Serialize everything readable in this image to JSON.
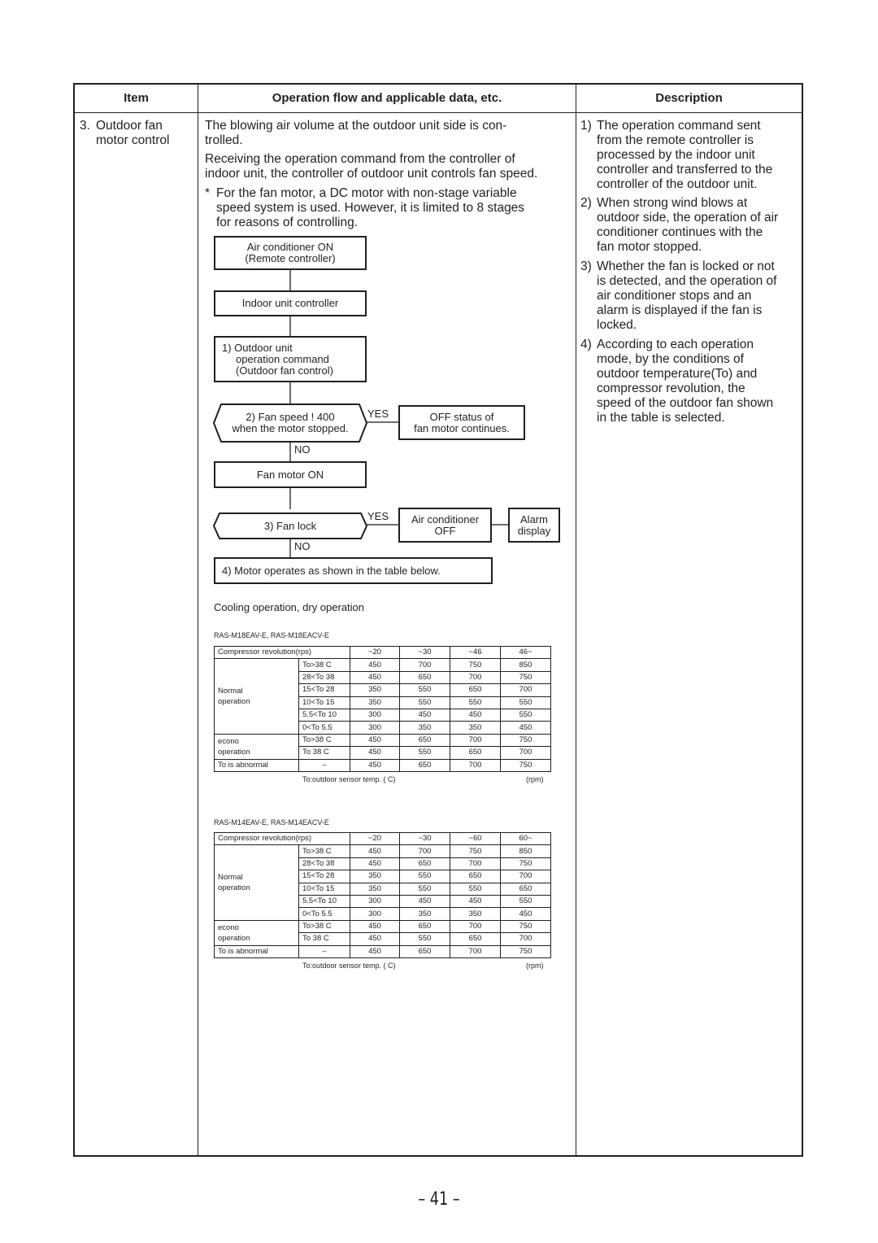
{
  "headers": {
    "item": "Item",
    "operation": "Operation flow and applicable data, etc.",
    "description": "Description"
  },
  "item": {
    "number": "3.",
    "line1": "Outdoor fan",
    "line2": "motor control"
  },
  "operation": {
    "para1_line1": "The blowing air volume at the outdoor unit side is con-",
    "para1_line2": "trolled.",
    "para2_line1": "Receiving the operation command from the controller of",
    "para2_line2": "indoor unit, the controller of outdoor unit controls fan speed.",
    "note_mark": "*",
    "note_line1": "For the fan motor, a DC motor with non-stage variable",
    "note_line2": "speed system is used. However, it is limited to 8 stages",
    "note_line3": "for reasons of controlling."
  },
  "flowchart": {
    "box_ac_on": [
      "Air conditioner ON",
      "(Remote controller)"
    ],
    "box_indoor": "Indoor unit controller",
    "box_outdoor_cmd": [
      "1)  Outdoor unit",
      "operation command",
      "(Outdoor fan control)"
    ],
    "decision_fan_speed": [
      "2) Fan speed !  400",
      "when the motor stopped."
    ],
    "box_off_status": [
      "OFF status of",
      "fan motor continues."
    ],
    "box_fan_on": "Fan motor ON",
    "decision_fan_lock": "3) Fan lock",
    "box_ac_off": [
      "Air conditioner",
      "OFF"
    ],
    "box_alarm": [
      "Alarm",
      "display"
    ],
    "box_motor_table": "4)  Motor operates as shown in the table below.",
    "yes_label": "YES",
    "no_label": "NO"
  },
  "tables_title": "Cooling operation, dry operation",
  "tables": [
    {
      "model": "RAS-M18EAV-E, RAS-M18EACV-E",
      "header_label": "Compressor revolution(rps)",
      "columns": [
        "~20",
        "~30",
        "~46",
        "46~"
      ],
      "groups": [
        {
          "label": [
            "Normal",
            "operation"
          ],
          "rows": [
            {
              "cond": "To>38  C",
              "values": [
                "450",
                "700",
                "750",
                "850"
              ]
            },
            {
              "cond": "28<To  38",
              "values": [
                "450",
                "650",
                "700",
                "750"
              ]
            },
            {
              "cond": "15<To  28",
              "values": [
                "350",
                "550",
                "650",
                "700"
              ]
            },
            {
              "cond": "10<To  15",
              "values": [
                "350",
                "550",
                "550",
                "550"
              ]
            },
            {
              "cond": "5.5<To  10",
              "values": [
                "300",
                "450",
                "450",
                "550"
              ]
            },
            {
              "cond": "0<To  5.5",
              "values": [
                "300",
                "350",
                "350",
                "450"
              ]
            }
          ]
        },
        {
          "label": [
            "econo",
            "operation"
          ],
          "rows": [
            {
              "cond": "To>38  C",
              "values": [
                "450",
                "650",
                "700",
                "750"
              ]
            },
            {
              "cond": "To  38  C",
              "values": [
                "450",
                "550",
                "650",
                "700"
              ]
            }
          ]
        },
        {
          "label": [
            "To is abnormal"
          ],
          "rows": [
            {
              "cond": "–",
              "values": [
                "450",
                "650",
                "700",
                "750"
              ]
            }
          ]
        }
      ],
      "footnote": "To:outdoor sensor temp. (  C)",
      "unit": "(rpm)"
    },
    {
      "model": "RAS-M14EAV-E, RAS-M14EACV-E",
      "header_label": "Compressor revolution(rps)",
      "columns": [
        "~20",
        "~30",
        "~60",
        "60~"
      ],
      "groups": [
        {
          "label": [
            "Normal",
            "operation"
          ],
          "rows": [
            {
              "cond": "To>38  C",
              "values": [
                "450",
                "700",
                "750",
                "850"
              ]
            },
            {
              "cond": "28<To  38",
              "values": [
                "450",
                "650",
                "700",
                "750"
              ]
            },
            {
              "cond": "15<To  28",
              "values": [
                "350",
                "550",
                "650",
                "700"
              ]
            },
            {
              "cond": "10<To  15",
              "values": [
                "350",
                "550",
                "550",
                "650"
              ]
            },
            {
              "cond": "5.5<To  10",
              "values": [
                "300",
                "450",
                "450",
                "550"
              ]
            },
            {
              "cond": "0<To  5.5",
              "values": [
                "300",
                "350",
                "350",
                "450"
              ]
            }
          ]
        },
        {
          "label": [
            "econo",
            "operation"
          ],
          "rows": [
            {
              "cond": "To>38  C",
              "values": [
                "450",
                "650",
                "700",
                "750"
              ]
            },
            {
              "cond": "To  38  C",
              "values": [
                "450",
                "550",
                "650",
                "700"
              ]
            }
          ]
        },
        {
          "label": [
            "To is abnormal"
          ],
          "rows": [
            {
              "cond": "–",
              "values": [
                "450",
                "650",
                "700",
                "750"
              ]
            }
          ]
        }
      ],
      "footnote": "To:outdoor sensor temp. (  C)",
      "unit": "(rpm)"
    }
  ],
  "description": [
    {
      "num": "1)",
      "lines": [
        "The operation command sent",
        "from the remote controller is",
        "processed by the indoor unit",
        "controller and transferred to the",
        "controller of the outdoor unit."
      ]
    },
    {
      "num": "2)",
      "lines": [
        "When strong wind blows at",
        "outdoor side, the operation of air",
        "conditioner continues with the",
        "fan motor stopped."
      ]
    },
    {
      "num": "3)",
      "lines": [
        "Whether the fan is locked or not",
        "is detected, and the operation of",
        "air conditioner stops and an",
        "alarm is displayed if the fan is",
        "locked."
      ]
    },
    {
      "num": "4)",
      "lines": [
        "According to each operation",
        "mode, by the conditions of",
        "outdoor temperature(To) and",
        "compressor revolution, the",
        "speed of the outdoor fan shown",
        "in the table is selected."
      ]
    }
  ],
  "page_number": "– 41 –"
}
